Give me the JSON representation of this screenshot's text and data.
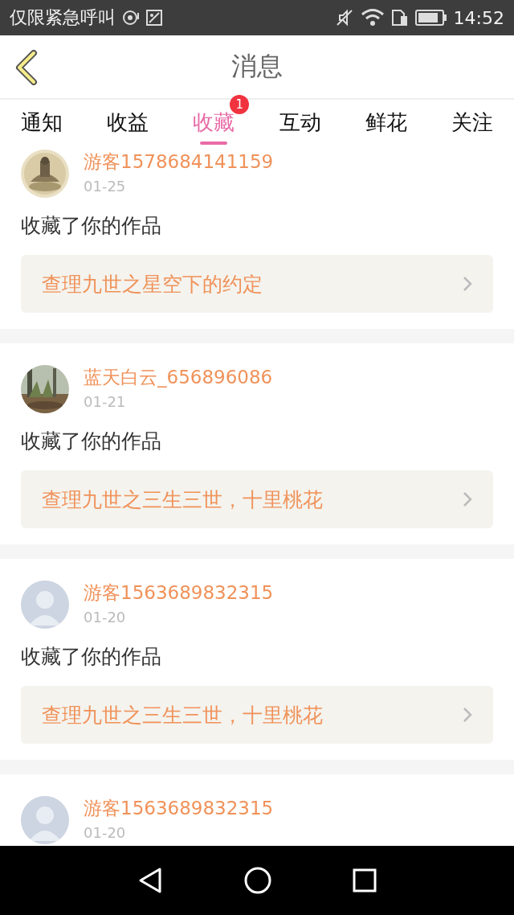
{
  "status_bar": {
    "carrier": "仅限紧急呼叫",
    "time": "14:52"
  },
  "header": {
    "title": "消息"
  },
  "tabs": [
    {
      "label": "通知",
      "selected": false
    },
    {
      "label": "收益",
      "selected": false
    },
    {
      "label": "收藏",
      "selected": true,
      "badge": "1"
    },
    {
      "label": "互动",
      "selected": false
    },
    {
      "label": "鲜花",
      "selected": false
    },
    {
      "label": "关注",
      "selected": false
    }
  ],
  "messages": [
    {
      "user": "游客1578684141159",
      "date": "01-25",
      "action": "收藏了你的作品",
      "work": "查理九世之星空下的约定"
    },
    {
      "user": "蓝天白云_656896086",
      "date": "01-21",
      "action": "收藏了你的作品",
      "work": "查理九世之三生三世，十里桃花"
    },
    {
      "avatar": {
        "kind": "default"
      },
      "user": "游客1563689832315",
      "date": "01-20",
      "action": "收藏了你的作品",
      "work": "查理九世之三生三世，十里桃花"
    },
    {
      "avatar": {
        "kind": "default"
      },
      "user": "游客1563689832315",
      "date": "01-20"
    }
  ]
}
